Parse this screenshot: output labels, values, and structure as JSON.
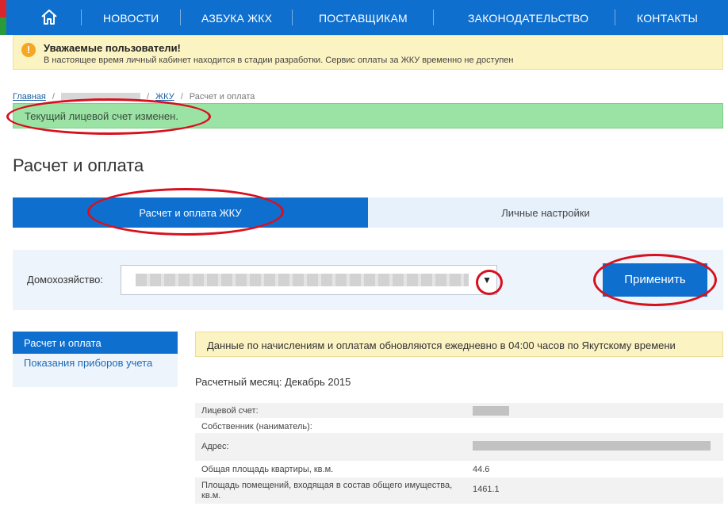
{
  "nav": {
    "items": [
      "НОВОСТИ",
      "АЗБУКА ЖКХ",
      "ПОСТАВЩИКАМ",
      "ЗАКОНОДАТЕЛЬСТВО",
      "КОНТАКТЫ"
    ],
    "home_icon": "home-icon",
    "color": "#0f6fce"
  },
  "warning": {
    "icon": "!",
    "title": "Уважаемые пользователи!",
    "text": "В настоящее время личный кабинет находится в стадии разработки. Сервис оплаты за ЖКУ временно не доступен"
  },
  "breadcrumb": {
    "home": "Главная",
    "sep": "/",
    "level2": "ЖКУ",
    "current": "Расчет и оплата"
  },
  "alert_success": "Текущий лицевой счет изменен.",
  "page_title": "Расчет и оплата",
  "tabs": {
    "active": "Расчет и оплата ЖКУ",
    "inactive": "Личные настройки"
  },
  "household": {
    "label": "Домохозяйство:",
    "caret": "▼",
    "apply_label": "Применить"
  },
  "sidebar": {
    "items": [
      "Расчет и оплата",
      "Показания приборов учета"
    ]
  },
  "info_box": "Данные по начислениям и оплатам обновляются ежедневно в 04:00 часов по Якутскому времени",
  "billing_month": "Расчетный месяц: Декабрь 2015",
  "details": {
    "rows": [
      {
        "key": "Лицевой счет:",
        "value": ""
      },
      {
        "key": "Собственник (наниматель):",
        "value": ""
      },
      {
        "key": "Адрес:",
        "value": ""
      },
      {
        "key": "Общая площадь квартиры, кв.м.",
        "value": "44.6"
      },
      {
        "key": "Площадь помещений, входящая в состав общего имущества, кв.м.",
        "value": "1461.1"
      }
    ]
  },
  "colors": {
    "primary": "#0f6fce",
    "warning_bg": "#fcf3c2",
    "success_bg": "#9be3a4",
    "annotation": "#d8101e"
  }
}
